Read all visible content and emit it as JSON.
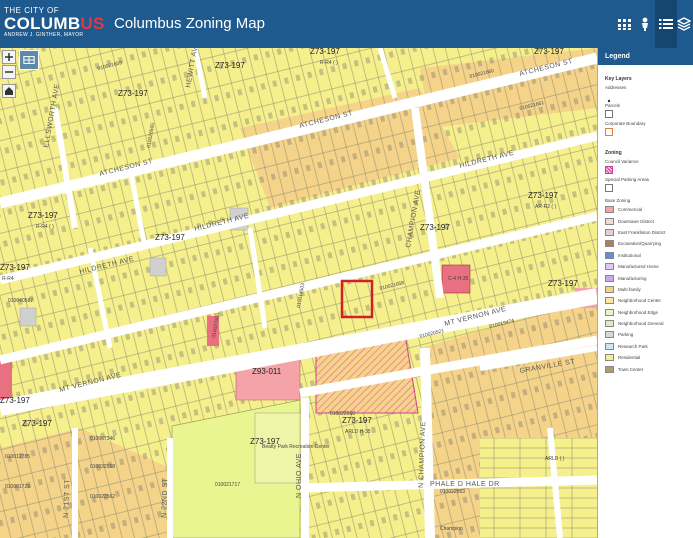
{
  "header": {
    "logo": {
      "line1": "THE CITY OF",
      "line2_a": "COLUMB",
      "line2_b": "US",
      "line3": "ANDREW J. GINTHER, MAYOR"
    },
    "title": "Columbus Zoning Map",
    "buttons": [
      {
        "name": "grid-tools-icon",
        "active": false
      },
      {
        "name": "person-icon",
        "active": false
      },
      {
        "name": "legend-list-icon",
        "active": true
      },
      {
        "name": "layers-icon",
        "active": false
      }
    ]
  },
  "map": {
    "streets": [
      "ATCHESON ST",
      "ATCHESON ST",
      "ATCHESON ST",
      "HILDRETH AVE",
      "HILDRETH AVE",
      "HILDRETH AVE",
      "MT VERNON AVE",
      "MT VERNON AVE",
      "GRANVILLE ST",
      "N CHAMPION AVE",
      "N 22ND ST",
      "N OHIO AVE",
      "PHALE D HALE DR",
      "CHAMPION AVE",
      "ELLSWORTH AVE",
      "HEWITT AVE",
      "N 21ST ST"
    ],
    "zone_labels": [
      "Z73-197",
      "Z73-197",
      "Z73-197",
      "Z73-197",
      "Z73-197",
      "Z73-197",
      "Z73-197",
      "Z73-197",
      "Z73-197",
      "Z73-197",
      "Z73-197",
      "Z73-197",
      "Z73-197",
      "Z73-197",
      "Z93-011"
    ],
    "sub_labels": [
      "R-R4 ( )",
      "R-R4 ( )",
      "AR-R2 ( )",
      "R-R4",
      "ARLD ( )",
      "ARLD H-35",
      "C-4 H-35"
    ],
    "place_labels": [
      "Beatty Park Recreation Center",
      "Champion"
    ],
    "parcel_ids": [
      "010021658",
      "010021659",
      "010021660",
      "010021661",
      "010040587",
      "010020521",
      "010019474",
      "010022560",
      "010067346",
      "010032558",
      "010022562",
      "010021717",
      "010012785",
      "010001729",
      "010022563",
      "010014503",
      "010026595",
      "010027005"
    ]
  },
  "legend": {
    "title": "Legend",
    "key_layers_heading": "Key Layers",
    "key_layers": [
      {
        "label": "Addresses",
        "symbol": "dot"
      },
      {
        "label": "Parcels",
        "symbol": "box"
      },
      {
        "label": "Corporate Boundary",
        "symbol": "orange-box"
      }
    ],
    "zoning_heading": "Zoning",
    "zoning_items": [
      {
        "label": "Council Variance",
        "symbol": "hatch-pink"
      },
      {
        "label": "Special Parking Areas",
        "symbol": "box"
      }
    ],
    "base_zoning_heading": "Base Zoning",
    "base_zoning": [
      {
        "label": "Commercial",
        "color": "#f4a3a8"
      },
      {
        "label": "Downtown District",
        "color": "#f2d8d8"
      },
      {
        "label": "East Franklinton District",
        "color": "#e6d0d0"
      },
      {
        "label": "Excavation/Quarrying",
        "color": "#b07c5a"
      },
      {
        "label": "Institutional",
        "color": "#6a8ed6"
      },
      {
        "label": "Manufactured Home",
        "color": "#e0c8f0"
      },
      {
        "label": "Manufacturing",
        "color": "#c8a8e8"
      },
      {
        "label": "Multi-family",
        "color": "#f5d48a"
      },
      {
        "label": "Neighborhood Center",
        "color": "#fbe8a8"
      },
      {
        "label": "Neighborhood Edge",
        "color": "#e8f5c8"
      },
      {
        "label": "Neighborhood General",
        "color": "#d8f0b8"
      },
      {
        "label": "Parking",
        "color": "#d8d8d8"
      },
      {
        "label": "Research Park",
        "color": "#c8e8f0"
      },
      {
        "label": "Residential",
        "color": "#f6f08c"
      },
      {
        "label": "Town Center",
        "color": "#a8a070"
      }
    ]
  },
  "colors": {
    "header": "#1f5a8e",
    "residential": "#f6f08c",
    "multi_family": "#f5d48a",
    "commercial": "#f4a3a8",
    "neighborhood_center": "#e8f590",
    "road": "#ffffff",
    "selection": "#d0202a"
  }
}
